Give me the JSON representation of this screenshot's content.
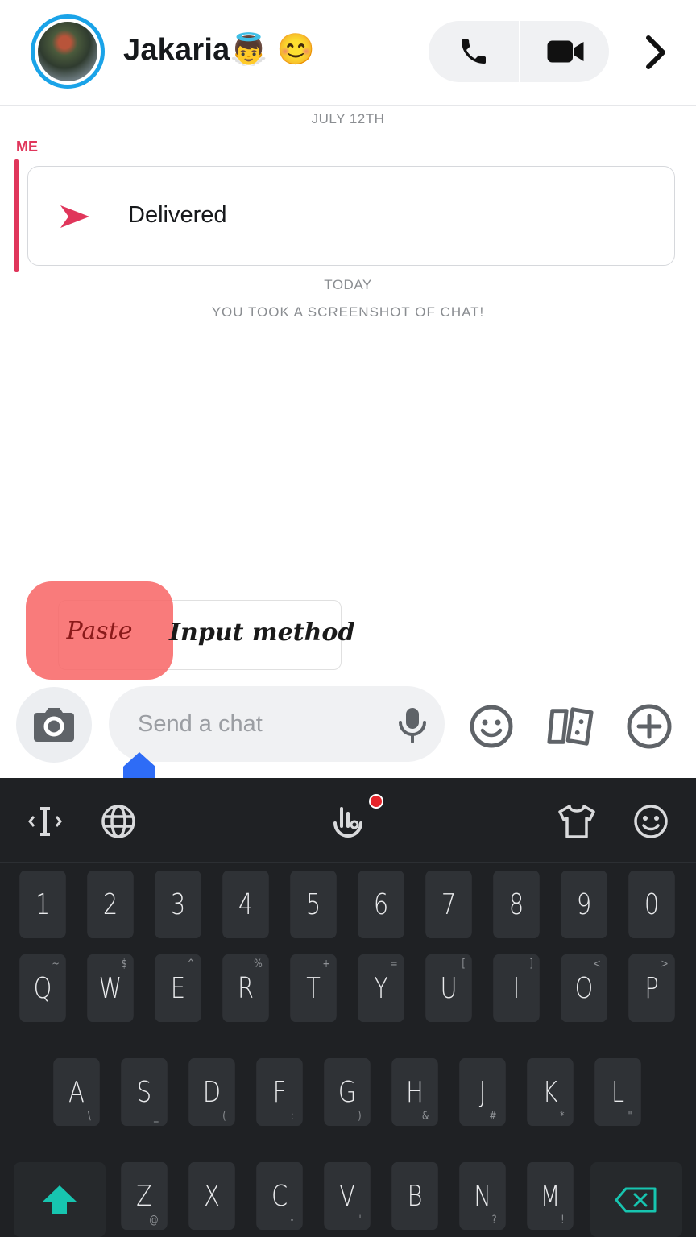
{
  "header": {
    "contact_name": "Jakaria👼 😊",
    "icons": [
      "avatar",
      "phone-icon",
      "video-icon",
      "chevron-right-icon"
    ]
  },
  "chat": {
    "date_1": "JULY 12TH",
    "sender": "ME",
    "message_status": "Delivered",
    "date_2": "TODAY",
    "system_note": "YOU TOOK A SCREENSHOT OF CHAT!"
  },
  "context_menu": {
    "paste": "Paste",
    "input_method": "Input method"
  },
  "composer": {
    "placeholder": "Send a chat",
    "icons": [
      "camera-icon",
      "mic-icon",
      "emoji-icon",
      "cards-icon",
      "plus-icon"
    ]
  },
  "keyboard": {
    "toolbar_icons": [
      "cursor-icon",
      "globe-icon",
      "voice-touch-icon",
      "shirt-icon",
      "emoji-icon"
    ],
    "row_numbers": [
      "1",
      "2",
      "3",
      "4",
      "5",
      "6",
      "7",
      "8",
      "9",
      "0"
    ],
    "row_1": [
      {
        "k": "Q",
        "t": "~"
      },
      {
        "k": "W",
        "t": "$"
      },
      {
        "k": "E",
        "t": "^"
      },
      {
        "k": "R",
        "t": "%"
      },
      {
        "k": "T",
        "t": "+"
      },
      {
        "k": "Y",
        "t": "="
      },
      {
        "k": "U",
        "t": "["
      },
      {
        "k": "I",
        "t": "]"
      },
      {
        "k": "O",
        "t": "<"
      },
      {
        "k": "P",
        "t": ">"
      }
    ],
    "row_2": [
      {
        "k": "A",
        "b": "\\"
      },
      {
        "k": "S",
        "b": "_"
      },
      {
        "k": "D",
        "b": "("
      },
      {
        "k": "F",
        "b": ":"
      },
      {
        "k": "G",
        "b": ")"
      },
      {
        "k": "H",
        "b": "&"
      },
      {
        "k": "J",
        "b": "#"
      },
      {
        "k": "K",
        "b": "*"
      },
      {
        "k": "L",
        "b": "\""
      }
    ],
    "row_3": [
      {
        "k": "Z",
        "b": "@"
      },
      {
        "k": "X",
        "b": ""
      },
      {
        "k": "C",
        "b": "-"
      },
      {
        "k": "V",
        "b": "'"
      },
      {
        "k": "B",
        "b": ""
      },
      {
        "k": "N",
        "b": "?"
      },
      {
        "k": "M",
        "b": "!"
      }
    ],
    "colors": {
      "shift": "#17c5b0",
      "accent_red": "#e0365b",
      "popup_highlight": "#f86464"
    }
  }
}
